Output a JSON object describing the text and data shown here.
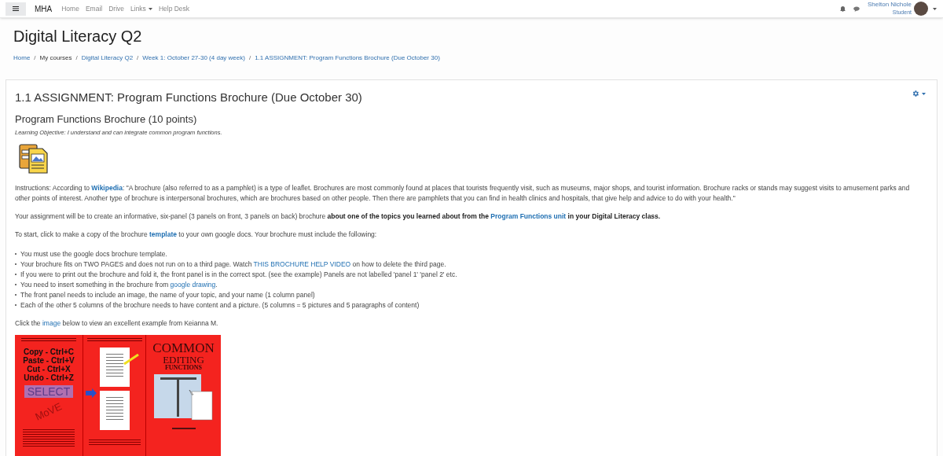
{
  "navbar": {
    "brand": "MHA",
    "links": [
      {
        "label": "Home",
        "dropdown": false
      },
      {
        "label": "Email",
        "dropdown": false
      },
      {
        "label": "Drive",
        "dropdown": false
      },
      {
        "label": "Links",
        "dropdown": true
      },
      {
        "label": "Help Desk",
        "dropdown": false
      }
    ]
  },
  "user": {
    "name": "Shelton Nichole",
    "role": "Student"
  },
  "page_title": "Digital Literacy Q2",
  "breadcrumb": [
    {
      "label": "Home",
      "link": true
    },
    {
      "separator": "/",
      "label": "My courses",
      "link": false
    },
    {
      "separator": "/",
      "label": "Digital Literacy Q2",
      "link": true
    },
    {
      "separator": "/",
      "label": "Week 1: October 27-30 (4 day week)",
      "link": true
    },
    {
      "separator": "/",
      "label": "1.1 ASSIGNMENT: Program Functions Brochure (Due October 30)",
      "link": true
    }
  ],
  "card": {
    "title": "1.1 ASSIGNMENT: Program Functions Brochure (Due October 30)",
    "heading": "Program Functions Brochure (10 points)",
    "objective": "Learning Objective: I understand and can integrate common program functions.",
    "paragraphs": [
      [
        {
          "kind": "text",
          "text": "Instructions: According to "
        },
        {
          "kind": "bold_link",
          "text": "Wikipedia"
        },
        {
          "kind": "text",
          "text": ": \"A brochure (also referred to as a pamphlet) is a type of leaflet. Brochures are most commonly found at places that tourists frequently visit, such as museums, major shops, and tourist information. Brochure racks or stands may suggest visits to amusement parks and other points of interest. Another type of brochure is interpersonal brochures, which are brochures based on other people. Then there are pamphlets that you can find in health clinics and hospitals, that give help and advice to do with your health.\""
        }
      ],
      [
        {
          "kind": "text",
          "text": "Your assignment will be to create an informative, six-panel (3 panels on front, 3 panels on back) brochure "
        },
        {
          "kind": "bold",
          "text": "about one of the topics you learned about from the "
        },
        {
          "kind": "bold_link",
          "text": "Program Functions unit"
        },
        {
          "kind": "bold",
          "text": " in your Digital Literacy class."
        }
      ],
      [
        {
          "kind": "text",
          "text": "To start, click to make a copy of the brochure "
        },
        {
          "kind": "bold_link",
          "text": "template"
        },
        {
          "kind": "text",
          "text": " to your own google docs. Your brochure must include the following:"
        }
      ]
    ],
    "bullets": [
      [
        {
          "kind": "text",
          "text": "You must use the google docs brochure template."
        }
      ],
      [
        {
          "kind": "text",
          "text": "Your brochure fits on TWO PAGES and does not run on to a third page. Watch "
        },
        {
          "kind": "link",
          "text": "THIS BROCHURE HELP VIDEO"
        },
        {
          "kind": "text",
          "text": " on how to delete the third page."
        }
      ],
      [
        {
          "kind": "text",
          "text": "If you were to print out the brochure and fold it, the front panel is in the correct spot. (see the example) Panels are not labelled 'panel 1' 'panel 2' etc."
        }
      ],
      [
        {
          "kind": "text",
          "text": "You need to insert something in the brochure from "
        },
        {
          "kind": "link",
          "text": "google drawing"
        },
        {
          "kind": "text",
          "text": "."
        }
      ],
      [
        {
          "kind": "text",
          "text": "The front panel needs to include an image, the name of your topic, and your name (1 column panel)"
        }
      ],
      [
        {
          "kind": "text",
          "text": "Each of the other 5 columns of the brochure needs to have content and a picture.  (5 columns = 5 pictures and 5 paragraphs of content)"
        }
      ]
    ],
    "closing": [
      {
        "kind": "text",
        "text": "Click the "
      },
      {
        "kind": "link",
        "text": "image"
      },
      {
        "kind": "text",
        "text": " below to view an excellent example from Keianna M."
      }
    ],
    "brochure": {
      "shortcuts": [
        "Copy - Ctrl+C",
        "Paste - Ctrl+V",
        "Cut - Ctrl+X",
        "Undo - Ctrl+Z"
      ],
      "select": "SELECT",
      "move": "MoVE",
      "title": [
        "COMMON",
        "EDITING",
        "FUNCTIONS"
      ]
    }
  }
}
